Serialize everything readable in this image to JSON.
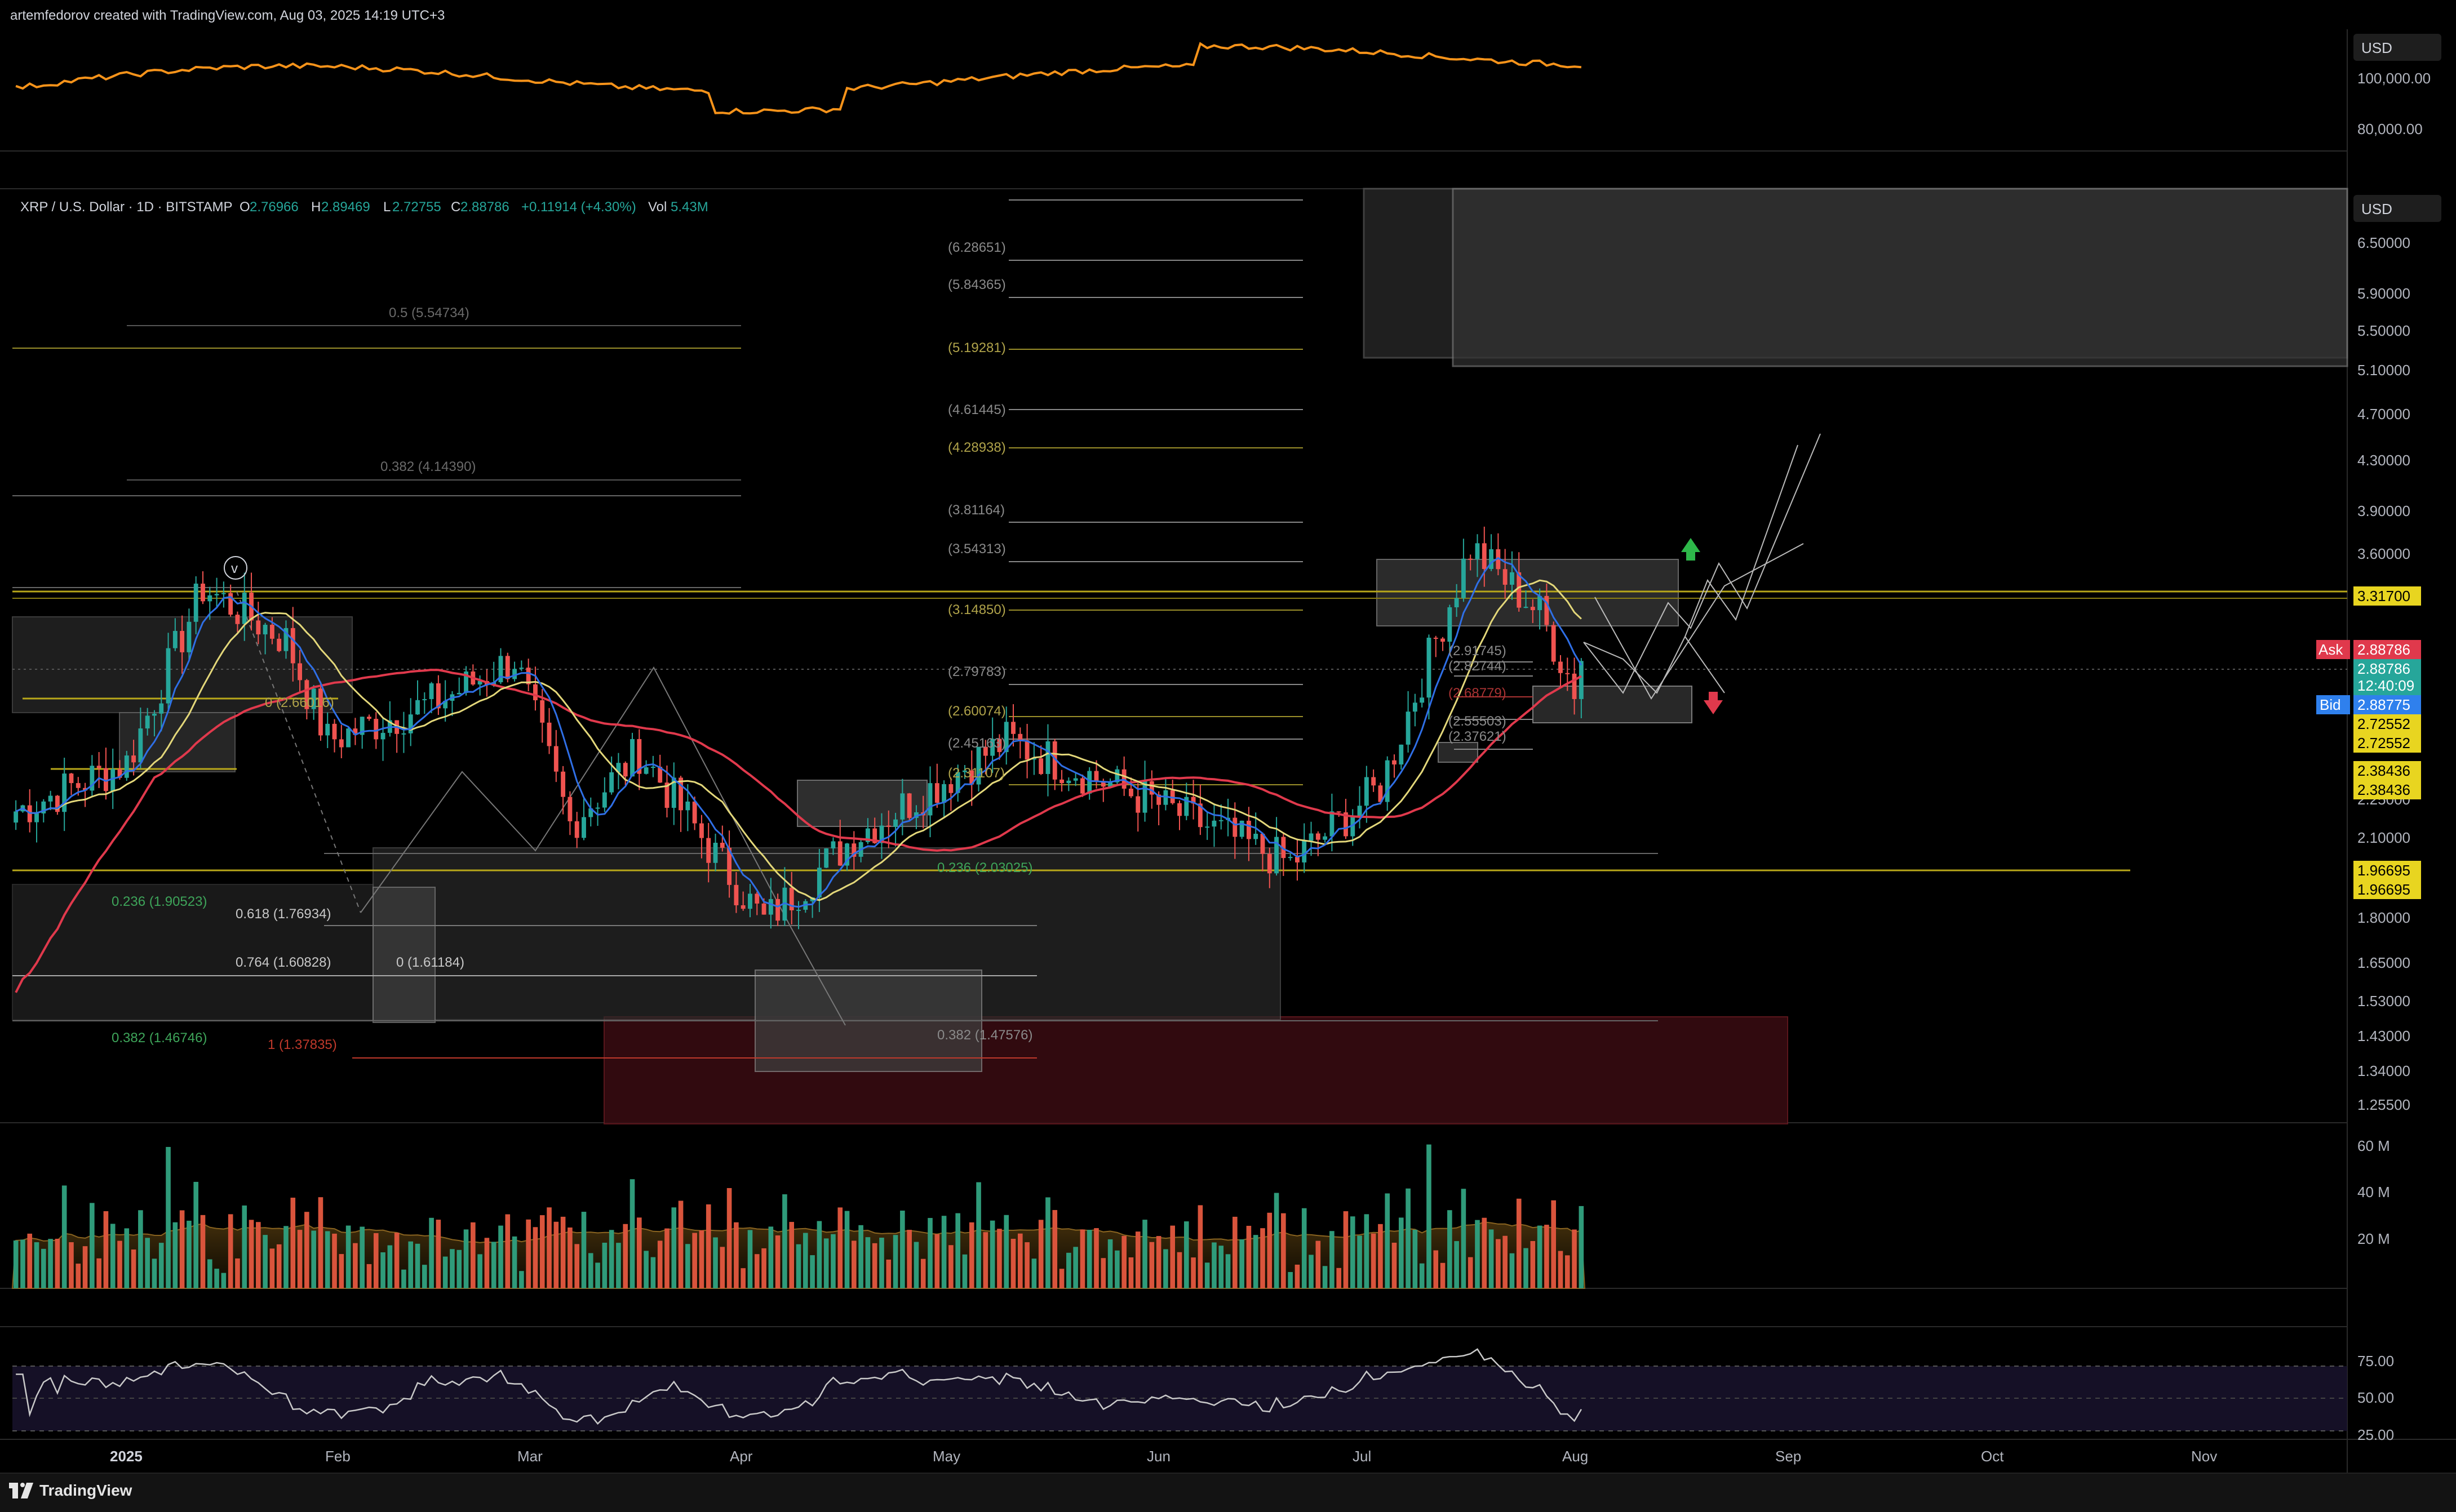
{
  "caption": "artemfedorov created with TradingView.com, Aug 03, 2025 14:19 UTC+3",
  "brand": "TradingView",
  "colors": {
    "background": "#000000",
    "up": "#26a69a",
    "down": "#ef5350",
    "ma_red": "#e0394c",
    "ma_yellow": "#e3d77a",
    "ma_blue": "#2f6fe6",
    "btc_line": "#f7931a",
    "gold_line": "#b8a71a",
    "fib_label": "#7c7c7c"
  },
  "top_pane": {
    "currency_label": "USD",
    "ticks": [
      "100,000.00",
      "80,000.00"
    ]
  },
  "main_pane": {
    "symbol": "XRP / U.S. Dollar · 1D · BITSTAMP",
    "ohlc": {
      "o_label": "O",
      "o": "2.76966",
      "h_label": "H",
      "h": "2.89469",
      "l_label": "L",
      "l": "2.72755",
      "c_label": "C",
      "c": "2.88786",
      "change": "+0.11914 (+4.30%)",
      "vol_label": "Vol",
      "vol": "5.43M"
    },
    "currency_label": "USD",
    "price_ticks": [
      "6.50000",
      "5.90000",
      "5.50000",
      "5.10000",
      "4.70000",
      "4.30000",
      "3.90000",
      "3.60000",
      "2.25000",
      "2.10000",
      "1.80000",
      "1.65000",
      "1.53000",
      "1.43000",
      "1.34000",
      "1.25500"
    ],
    "price_tags": {
      "level_gold": "3.31700",
      "ask_label": "Ask",
      "ask": "2.88786",
      "last": "2.88786",
      "countdown": "12:40:09",
      "bid_label": "Bid",
      "bid": "2.88775",
      "y1": "2.72552",
      "y2": "2.72552",
      "y3": "2.38436",
      "y4": "2.38436",
      "y5": "1.96695",
      "y6": "1.96695"
    },
    "fib_labels_right": [
      "(6.28651)",
      "(5.84365)",
      "(5.19281)",
      "(4.61445)",
      "(4.28938)",
      "(3.81164)",
      "(3.54313)",
      "(3.14850)",
      "(2.79783)",
      "(2.60074)",
      "(2.45163)",
      "(2.31107)"
    ],
    "fib_labels_left": {
      "f05": "0.5 (5.54734)",
      "f0382_top": "0.382 (4.14390)",
      "f0": "0 (2.66016)",
      "f0236_left": "0.236 (1.90523)",
      "f0618": "0.618 (1.76934)",
      "f0764": "0.764 (1.60828)",
      "f0_b": "0 (1.61184)",
      "f0382_left": "0.382 (1.46746)",
      "f1": "1 (1.37835)",
      "f0236_mid": "0.236 (2.03025)",
      "f0382_mid": "0.382 (1.47576)"
    },
    "inner_labels": [
      "(2.91745)",
      "(2.82744)",
      "(2.68779)",
      "(2.55503)",
      "(2.37621)"
    ],
    "wave_label": "v"
  },
  "volume_pane": {
    "ticks": [
      "60 M",
      "40 M",
      "20 M"
    ]
  },
  "rsi_pane": {
    "ticks": [
      "75.00",
      "50.00",
      "25.00"
    ]
  },
  "time_axis": {
    "labels": [
      "2025",
      "Feb",
      "Mar",
      "Apr",
      "May",
      "Jun",
      "Jul",
      "Aug",
      "Sep",
      "Oct",
      "Nov"
    ]
  },
  "chart_data": [
    {
      "type": "line",
      "name": "",
      "y_ticks": [
        100000,
        80000
      ],
      "note_series": "price of comparison asset, top pane"
    },
    {
      "type": "candlestick",
      "title": "XRP / U.S. Dollar · 1D · BITSTAMP",
      "x_labels": [
        "2025",
        "Feb",
        "Mar",
        "Apr",
        "May",
        "Jun",
        "Jul",
        "Aug",
        "Sep",
        "Oct",
        "Nov"
      ],
      "y_scale": "log",
      "ylim": [
        1.25,
        6.8
      ],
      "last_close": 2.88786,
      "key_close_points": [
        {
          "x": "2024-12-20",
          "y": 2.2
        },
        {
          "x": "2025-01-05",
          "y": 2.4
        },
        {
          "x": "2025-01-16",
          "y": 3.3
        },
        {
          "x": "2025-01-28",
          "y": 3.0
        },
        {
          "x": "2025-02-03",
          "y": 2.5
        },
        {
          "x": "2025-02-20",
          "y": 2.7
        },
        {
          "x": "2025-03-02",
          "y": 2.9
        },
        {
          "x": "2025-03-10",
          "y": 2.15
        },
        {
          "x": "2025-03-20",
          "y": 2.45
        },
        {
          "x": "2025-04-07",
          "y": 1.8
        },
        {
          "x": "2025-04-20",
          "y": 2.1
        },
        {
          "x": "2025-05-12",
          "y": 2.5
        },
        {
          "x": "2025-06-01",
          "y": 2.25
        },
        {
          "x": "2025-06-22",
          "y": 2.0
        },
        {
          "x": "2025-07-05",
          "y": 2.3
        },
        {
          "x": "2025-07-18",
          "y": 3.55
        },
        {
          "x": "2025-07-28",
          "y": 3.15
        },
        {
          "x": "2025-08-02",
          "y": 2.75
        },
        {
          "x": "2025-08-03",
          "y": 2.88786
        }
      ]
    },
    {
      "type": "bar",
      "name": "",
      "y_ticks": [
        "60 M",
        "40 M",
        "20 M"
      ],
      "last_volume": "5.43M"
    },
    {
      "type": "line",
      "name": "",
      "ylim": [
        25,
        75
      ],
      "y_ticks": [
        75,
        50,
        25
      ]
    }
  ]
}
